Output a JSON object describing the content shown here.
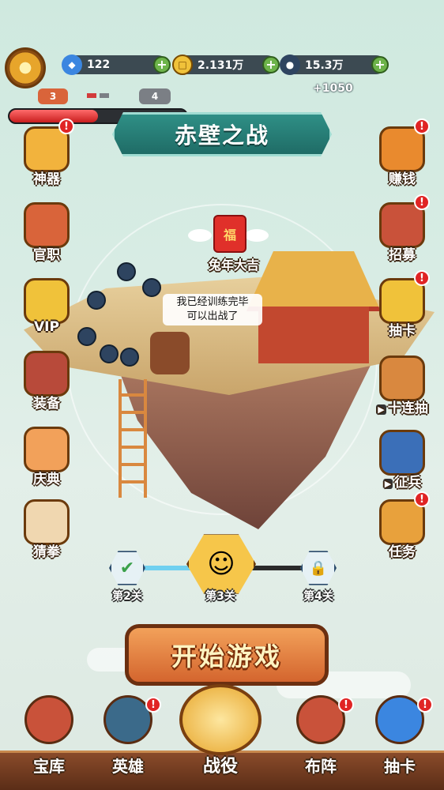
{
  "resources": {
    "gems": {
      "value": "122",
      "icon": "blue-gem-icon"
    },
    "coins": {
      "value": "2.131万",
      "icon": "gold-coin-icon"
    },
    "troops": {
      "value": "15.3万",
      "icon": "soldier-head-icon"
    },
    "troops_bonus": "+1050"
  },
  "wave": {
    "current": "3",
    "next": "4",
    "progress": 0.5
  },
  "title": "赤壁之战",
  "left_menu": [
    {
      "label": "神器",
      "icon": "axe-icon",
      "badge": "!"
    },
    {
      "label": "官职",
      "icon": "scroll-seal-icon",
      "badge": ""
    },
    {
      "label": "VIP",
      "icon": "gold-ingot-icon",
      "badge": ""
    },
    {
      "label": "装备",
      "icon": "war-horse-icon",
      "badge": ""
    },
    {
      "label": "庆典",
      "icon": "treasure-bag-icon",
      "badge": ""
    },
    {
      "label": "猜拳",
      "icon": "victory-hand-icon",
      "badge": ""
    }
  ],
  "right_menu": [
    {
      "label": "赚钱",
      "icon": "coin-sack-icon",
      "badge": "!"
    },
    {
      "label": "招募",
      "icon": "drum-icon",
      "badge": "!"
    },
    {
      "label": "抽卡",
      "icon": "card-scroll-icon",
      "badge": "!"
    },
    {
      "label": "十连抽",
      "icon": "gourd-icon",
      "badge": "",
      "video": "▶"
    },
    {
      "label": "征兵",
      "icon": "blue-book-icon",
      "badge": "",
      "video": "▶"
    },
    {
      "label": "任务",
      "icon": "quest-scroll-icon",
      "badge": "!"
    }
  ],
  "event": {
    "label": "兔年大吉",
    "bag_text": "福"
  },
  "speech": {
    "line1": "我已经训练完毕",
    "line2": "可以出战了"
  },
  "levels": [
    {
      "label": "第2关",
      "state": "cleared",
      "icon": "checkmark-icon",
      "glyph": "✔"
    },
    {
      "label": "第3关",
      "state": "current",
      "icon": "general-portrait-icon",
      "glyph": "☺"
    },
    {
      "label": "第4关",
      "state": "locked",
      "icon": "lock-icon",
      "glyph": "🔒"
    }
  ],
  "start_button": "开始游戏",
  "bottom_nav": [
    {
      "label": "宝库",
      "icon": "treasure-chest-icon",
      "badge": ""
    },
    {
      "label": "英雄",
      "icon": "helmet-icon",
      "badge": "!"
    },
    {
      "label": "战役",
      "icon": "battle-flag-icon",
      "badge": "",
      "active": true
    },
    {
      "label": "布阵",
      "icon": "war-drum-icon",
      "badge": "!"
    },
    {
      "label": "抽卡",
      "icon": "card-pack-icon",
      "badge": "!"
    }
  ],
  "colors": {
    "accent_red": "#e02424",
    "banner_teal": "#1f6c66",
    "button_orange": "#d4652e"
  }
}
